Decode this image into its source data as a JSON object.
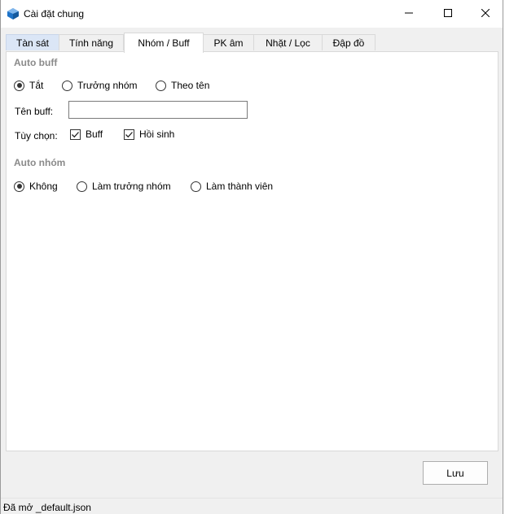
{
  "window": {
    "title": "Cài đặt chung"
  },
  "tabs": [
    {
      "label": "Tàn sát"
    },
    {
      "label": "Tính năng"
    },
    {
      "label": "Nhóm / Buff"
    },
    {
      "label": "PK âm"
    },
    {
      "label": "Nhặt / Lọc"
    },
    {
      "label": "Đập đồ"
    }
  ],
  "active_tab": "Nhóm / Buff",
  "auto_buff": {
    "title": "Auto buff",
    "mode_options": [
      {
        "label": "Tắt",
        "checked": true
      },
      {
        "label": "Trưởng nhóm",
        "checked": false
      },
      {
        "label": "Theo tên",
        "checked": false
      }
    ],
    "name_label": "Tên buff:",
    "name_value": "",
    "options_label": "Tùy chọn:",
    "checkboxes": [
      {
        "label": "Buff",
        "checked": true
      },
      {
        "label": "Hồi sinh",
        "checked": true
      }
    ]
  },
  "auto_group": {
    "title": "Auto nhóm",
    "options": [
      {
        "label": "Không",
        "checked": true
      },
      {
        "label": "Làm trưởng nhóm",
        "checked": false
      },
      {
        "label": "Làm thành viên",
        "checked": false
      }
    ]
  },
  "save_label": "Lưu",
  "status": "Đã mở _default.json",
  "colors": {
    "accent": "#1e73c8",
    "section_title": "#8a8a8a"
  }
}
